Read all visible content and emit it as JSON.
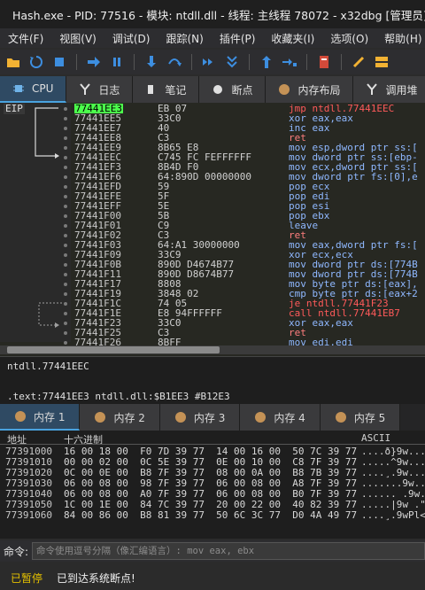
{
  "window": {
    "title": "Hash.exe - PID: 77516 - 模块: ntdll.dll - 线程: 主线程 78072 - x32dbg [管理员]"
  },
  "menu": [
    "文件(F)",
    "视图(V)",
    "调试(D)",
    "跟踪(N)",
    "插件(P)",
    "收藏夹(I)",
    "选项(O)",
    "帮助(H)"
  ],
  "toolbar": [
    {
      "name": "open-icon",
      "color": "#f2b233"
    },
    {
      "name": "restart-icon",
      "color": "#3d8ee0"
    },
    {
      "name": "stop-icon",
      "color": "#3d8ee0"
    },
    {
      "name": "run-icon",
      "color": "#3d8ee0"
    },
    {
      "name": "pause-icon",
      "color": "#3d8ee0"
    },
    {
      "name": "step-into-icon",
      "color": "#3d8ee0"
    },
    {
      "name": "step-over-icon",
      "color": "#3d8ee0"
    },
    {
      "name": "trace-into-icon",
      "color": "#3d8ee0"
    },
    {
      "name": "trace-over-icon",
      "color": "#3d8ee0"
    },
    {
      "name": "execute-till-return-icon",
      "color": "#3d8ee0"
    },
    {
      "name": "run-to-user-code-icon",
      "color": "#3d8ee0"
    },
    {
      "name": "script-icon",
      "color": "#d24a3a"
    },
    {
      "name": "patch-icon",
      "color": "#f2b233"
    },
    {
      "name": "comments-icon",
      "color": "#f2b233"
    }
  ],
  "tabs": [
    {
      "label": "CPU",
      "icon": "cpu-icon",
      "active": true
    },
    {
      "label": "日志",
      "icon": "log-icon",
      "active": false
    },
    {
      "label": "笔记",
      "icon": "notes-icon",
      "active": false
    },
    {
      "label": "断点",
      "icon": "breakpoints-icon",
      "active": false
    },
    {
      "label": "内存布局",
      "icon": "memory-map-icon",
      "active": false
    },
    {
      "label": "调用堆",
      "icon": "call-stack-icon",
      "active": false
    }
  ],
  "disassembly": {
    "eip_label": "EIP",
    "rows": [
      {
        "addr": "77441EE3",
        "bytes": "EB 07",
        "instr": "jmp ntdll.77441EEC",
        "kind": "jmp",
        "current": true
      },
      {
        "addr": "77441EE5",
        "bytes": "33C0",
        "instr": "xor eax,eax",
        "kind": "norm"
      },
      {
        "addr": "77441EE7",
        "bytes": "40",
        "instr": "inc eax",
        "kind": "norm"
      },
      {
        "addr": "77441EE8",
        "bytes": "C3",
        "instr": "ret",
        "kind": "ret"
      },
      {
        "addr": "77441EE9",
        "bytes": "8B65 E8",
        "instr": "mov esp,dword ptr ss:[",
        "kind": "norm"
      },
      {
        "addr": "77441EEC",
        "bytes": "C745 FC FEFFFFFF",
        "instr": "mov dword ptr ss:[ebp-",
        "kind": "norm"
      },
      {
        "addr": "77441EF3",
        "bytes": "8B4D F0",
        "instr": "mov ecx,dword ptr ss:[",
        "kind": "norm"
      },
      {
        "addr": "77441EF6",
        "bytes": "64:890D 00000000",
        "instr": "mov dword ptr fs:[0],e",
        "kind": "norm"
      },
      {
        "addr": "77441EFD",
        "bytes": "59",
        "instr": "pop ecx",
        "kind": "norm"
      },
      {
        "addr": "77441EFE",
        "bytes": "5F",
        "instr": "pop edi",
        "kind": "norm"
      },
      {
        "addr": "77441EFF",
        "bytes": "5E",
        "instr": "pop esi",
        "kind": "norm"
      },
      {
        "addr": "77441F00",
        "bytes": "5B",
        "instr": "pop ebx",
        "kind": "norm"
      },
      {
        "addr": "77441F01",
        "bytes": "C9",
        "instr": "leave",
        "kind": "norm"
      },
      {
        "addr": "77441F02",
        "bytes": "C3",
        "instr": "ret",
        "kind": "ret"
      },
      {
        "addr": "77441F03",
        "bytes": "64:A1 30000000",
        "instr": "mov eax,dword ptr fs:[",
        "kind": "norm"
      },
      {
        "addr": "77441F09",
        "bytes": "33C9",
        "instr": "xor ecx,ecx",
        "kind": "norm"
      },
      {
        "addr": "77441F0B",
        "bytes": "890D D4674B77",
        "instr": "mov dword ptr ds:[774B",
        "kind": "norm"
      },
      {
        "addr": "77441F11",
        "bytes": "890D D8674B77",
        "instr": "mov dword ptr ds:[774B",
        "kind": "norm"
      },
      {
        "addr": "77441F17",
        "bytes": "8808",
        "instr": "mov byte ptr ds:[eax],",
        "kind": "norm"
      },
      {
        "addr": "77441F19",
        "bytes": "3848 02",
        "instr": "cmp byte ptr ds:[eax+2",
        "kind": "norm"
      },
      {
        "addr": "77441F1C",
        "bytes": "74 05",
        "instr": "je ntdll.77441F23",
        "kind": "jmp"
      },
      {
        "addr": "77441F1E",
        "bytes": "E8 94FFFFFF",
        "instr": "call ntdll.77441EB7",
        "kind": "jmp"
      },
      {
        "addr": "77441F23",
        "bytes": "33C0",
        "instr": "xor eax,eax",
        "kind": "norm"
      },
      {
        "addr": "77441F25",
        "bytes": "C3",
        "instr": "ret",
        "kind": "ret"
      },
      {
        "addr": "77441F26",
        "bytes": "8BFF",
        "instr": "mov edi,edi",
        "kind": "norm"
      }
    ]
  },
  "info": {
    "line1": "ntdll.77441EEC",
    "line2": ".text:77441EE3 ntdll.dll:$B1EE3 #B12E3"
  },
  "memtabs": [
    {
      "label": "内存 1",
      "active": true
    },
    {
      "label": "内存 2",
      "active": false
    },
    {
      "label": "内存 3",
      "active": false
    },
    {
      "label": "内存 4",
      "active": false
    },
    {
      "label": "内存 5",
      "active": false
    }
  ],
  "dump": {
    "headers": {
      "address": "地址",
      "hex": "十六进制",
      "ascii": "ASCII"
    },
    "rows": [
      {
        "addr": "77391000",
        "hex": "16 00 18 00  F0 7D 39 77  14 00 16 00  50 7C 39 77",
        "ascii": "....ð}9w....P|9w"
      },
      {
        "addr": "77391010",
        "hex": "00 00 02 00  0C 5E 39 77  0E 00 10 00  C8 7F 39 77",
        "ascii": ".....^9w....È.9w"
      },
      {
        "addr": "77391020",
        "hex": "0C 00 0E 00  B8 7F 39 77  08 00 0A 00  B8 7B 39 77",
        "ascii": "....¸.9w....¸{9w"
      },
      {
        "addr": "77391030",
        "hex": "06 00 08 00  98 7F 39 77  06 00 08 00  A8 7F 39 77",
        "ascii": ".......9w.....9w"
      },
      {
        "addr": "77391040",
        "hex": "06 00 08 00  A0 7F 39 77  06 00 08 00  B0 7F 39 77",
        "ascii": "...... .9w....°.9w"
      },
      {
        "addr": "77391050",
        "hex": "1C 00 1E 00  84 7C 39 77  20 00 22 00  40 82 39 77",
        "ascii": ".....|9w .\".@.9w"
      },
      {
        "addr": "77391060",
        "hex": "84 00 86 00  B8 81 39 77  50 6C 3C 77  D0 4A 49 77",
        "ascii": "....¸.9wPl<wÐJIw"
      }
    ]
  },
  "command": {
    "label": "命令:",
    "placeholder": "命令使用逗号分隔（像汇编语言）: mov eax, ebx"
  },
  "status": {
    "state": "已暂停",
    "message": "已到达系统断点!"
  }
}
